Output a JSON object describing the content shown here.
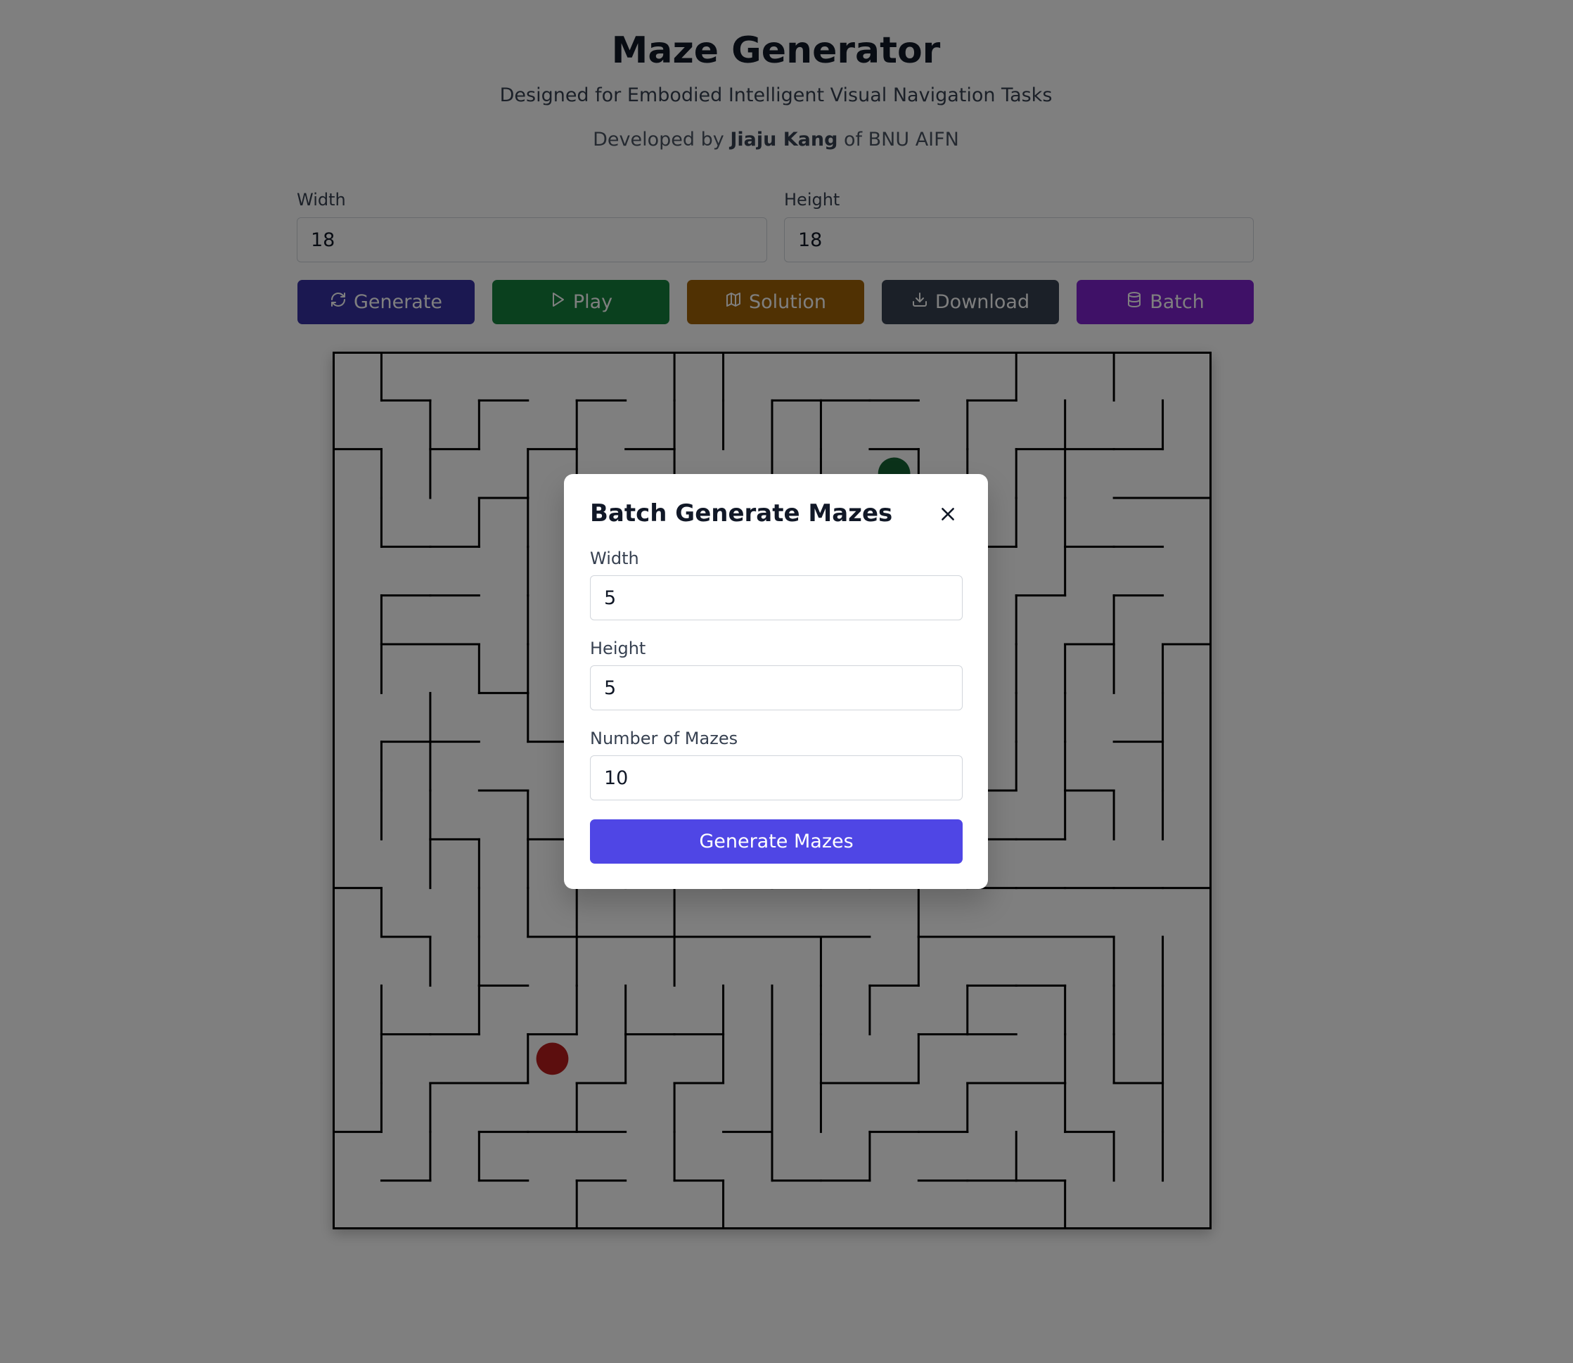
{
  "header": {
    "title": "Maze Generator",
    "subtitle": "Designed for Embodied Intelligent Visual Navigation Tasks",
    "credit_prefix": "Developed by",
    "credit_author": "Jiaju Kang",
    "credit_suffix": "of BNU AIFN"
  },
  "controls": {
    "width_label": "Width",
    "width_value": "18",
    "height_label": "Height",
    "height_value": "18"
  },
  "toolbar": {
    "generate_label": "Generate",
    "play_label": "Play",
    "solution_label": "Solution",
    "download_label": "Download",
    "batch_label": "Batch"
  },
  "colors": {
    "generate": "#3730a3",
    "play": "#15803d",
    "solution": "#a16207",
    "download": "#374151",
    "batch": "#7e22ce",
    "submit": "#4f46e5",
    "start_marker": "#166534",
    "end_marker": "#b91c1c",
    "overlay": "rgba(0,0,0,0.5)"
  },
  "icons": {
    "generate": "refresh-icon",
    "play": "play-icon",
    "solution": "map-icon",
    "download": "download-icon",
    "batch": "database-icon",
    "close": "close-icon"
  },
  "maze": {
    "cols": 18,
    "rows": 18,
    "start": {
      "col": 11,
      "row": 2
    },
    "end": {
      "col": 4,
      "row": 14
    }
  },
  "batch_modal": {
    "title": "Batch Generate Mazes",
    "width_label": "Width",
    "width_value": "5",
    "height_label": "Height",
    "height_value": "5",
    "count_label": "Number of Mazes",
    "count_value": "10",
    "submit_label": "Generate Mazes"
  }
}
